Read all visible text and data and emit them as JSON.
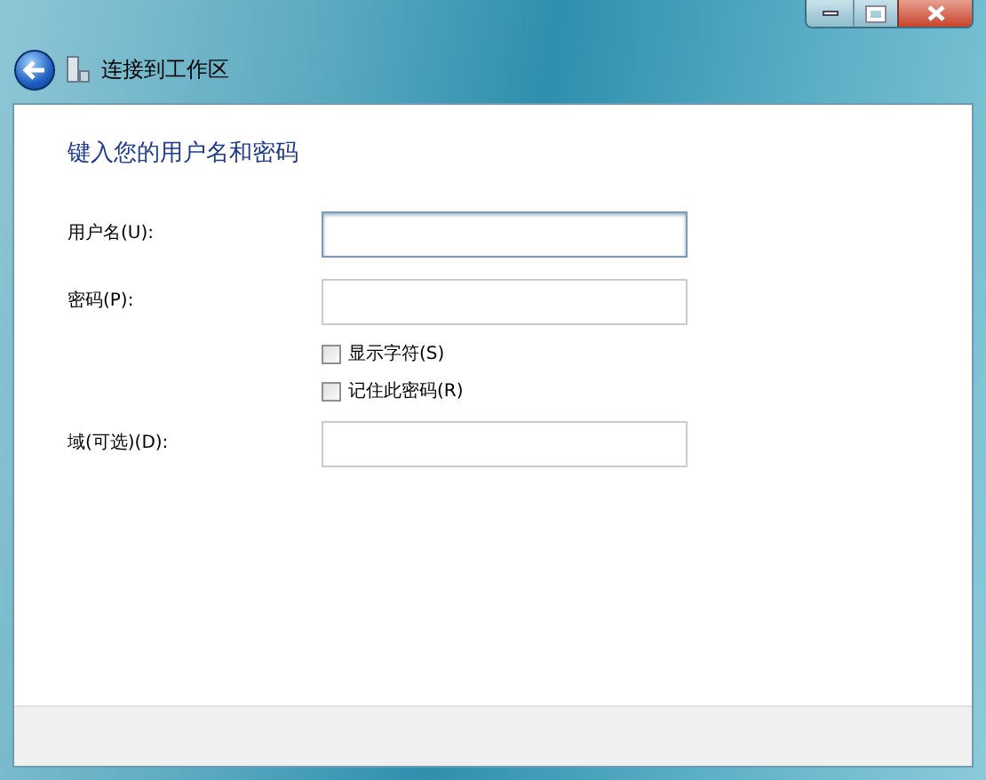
{
  "window": {
    "title": "连接到工作区"
  },
  "heading": "键入您的用户名和密码",
  "rows": [
    {
      "kind": "field",
      "label": "用户名(U):",
      "focused": true
    },
    {
      "kind": "field",
      "label": "密码(P):",
      "focused": false
    },
    {
      "kind": "checkbox",
      "label": "显示字符(S)",
      "checked": false
    },
    {
      "kind": "checkbox",
      "label": "记住此密码(R)",
      "checked": false
    },
    {
      "kind": "field",
      "label": "域(可选)(D):",
      "focused": false
    }
  ]
}
